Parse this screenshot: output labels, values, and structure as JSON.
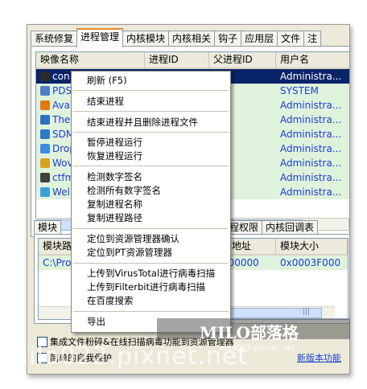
{
  "tabs": [
    "系统修复",
    "进程管理",
    "内核模块",
    "内核相关",
    "钩子",
    "应用层",
    "文件",
    "注"
  ],
  "active_tab": 1,
  "columns": [
    "映像名称",
    "进程ID",
    "父进程ID",
    "用户名"
  ],
  "processes": [
    {
      "name": "con",
      "pid": "",
      "ppid": "12",
      "user": "Administra..."
    },
    {
      "name": "PDS",
      "pid": "",
      "ppid": "08",
      "user": "SYSTEM"
    },
    {
      "name": "Ava",
      "pid": "",
      "ppid": "92",
      "user": "Administra..."
    },
    {
      "name": "The",
      "pid": "",
      "ppid": "92",
      "user": "Administra..."
    },
    {
      "name": "SDM",
      "pid": "",
      "ppid": "64",
      "user": "Administra..."
    },
    {
      "name": "Drop",
      "pid": "",
      "ppid": "92",
      "user": "Administra..."
    },
    {
      "name": "Wov",
      "pid": "",
      "ppid": "12",
      "user": "Administra..."
    },
    {
      "name": "ctfm",
      "pid": "",
      "ppid": "96",
      "user": "Administra..."
    },
    {
      "name": "Wel",
      "pid": "",
      "ppid": "92",
      "user": "Administra..."
    }
  ],
  "icon_colors": [
    "#2b2b2b",
    "#4f7fc4",
    "#e07a10",
    "#2e6fbf",
    "#2f78c8",
    "#3a8be0",
    "#d9a020",
    "#404040",
    "#3aa0d8"
  ],
  "bottom_tabs": [
    "模块",
    "程",
    "进程权限",
    "内核回调表"
  ],
  "bottom_columns": [
    "模块路",
    "",
    "基地址",
    "模块大小"
  ],
  "bottom_rows": [
    {
      "path": "C:\\Pro",
      "base": "000000",
      "size": "0x0003F000"
    }
  ],
  "checkboxes": [
    "集成文件粉碎&在线扫描病毒功能到资源管理器",
    "简单的自我保护"
  ],
  "link_text": "新版本功能",
  "context_menu": [
    "刷新 (F5)",
    "结束进程",
    "结束进程并且删除进程文件",
    "暂停进程运行",
    "恢复进程运行",
    "检测数字签名",
    "检测所有数字签名",
    "复制进程名称",
    "复制进程路径",
    "定位到资源管理器确认",
    "定位到PT资源管理器",
    "上传到VirusTotal进行病毒扫描",
    "上传到Filterbit进行病毒扫描",
    "在百度搜索",
    "导出"
  ],
  "watermark": {
    "brand": "MILO部落格",
    "site": "milo022.pixnet.net",
    "sub": "milo022.pixnet.net"
  }
}
